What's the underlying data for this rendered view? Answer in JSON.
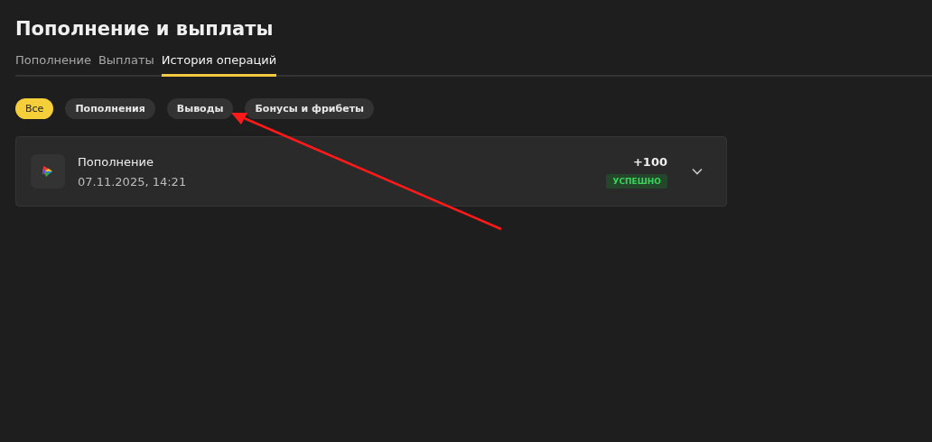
{
  "title": "Пополнение и выплаты",
  "tabs": [
    {
      "label": "Пополнение",
      "selected": false
    },
    {
      "label": "Выплаты",
      "selected": false
    },
    {
      "label": "История операций",
      "selected": true
    }
  ],
  "filters": [
    {
      "label": "Все",
      "selected": true
    },
    {
      "label": "Пополнения",
      "selected": false
    },
    {
      "label": "Выводы",
      "selected": false
    },
    {
      "label": "Бонусы и фрибеты",
      "selected": false
    }
  ],
  "operations": [
    {
      "name": "Пополнение",
      "date": "07.11.2025, 14:21",
      "amount": "+100",
      "status": "УСПЕШНО",
      "expanded": false
    }
  ]
}
